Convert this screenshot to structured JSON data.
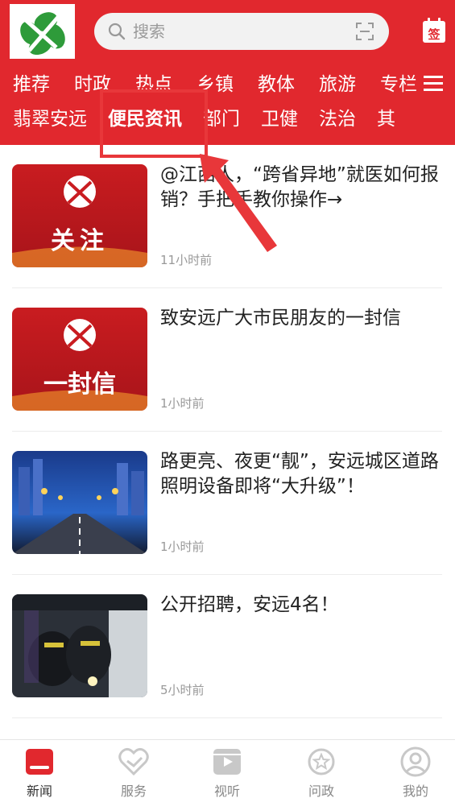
{
  "header": {
    "search": {
      "placeholder": "搜索"
    },
    "signin_label": "签"
  },
  "channels_row1": [
    "推荐",
    "时政",
    "热点",
    "乡镇",
    "教体",
    "旅游",
    "专栏"
  ],
  "channels_row2": [
    "翡翠安远",
    "便民资讯",
    "部门",
    "卫健",
    "法治",
    "其"
  ],
  "active_channel": "便民资讯",
  "feed": [
    {
      "title": "@江西人，“跨省异地”就医如何报销？手把手教你操作→",
      "time": "11小时前",
      "thumb_text": "关注"
    },
    {
      "title": "致安远广大市民朋友的一封信",
      "time": "1小时前",
      "thumb_text": "一封信"
    },
    {
      "title": "路更亮、夜更“靓”，安远城区道路照明设备即将“大升级”！",
      "time": "1小时前",
      "thumb_text": ""
    },
    {
      "title": "公开招聘，安远4名！",
      "time": "5小时前",
      "thumb_text": ""
    }
  ],
  "bottom_nav": [
    {
      "label": "新闻",
      "icon": "news-icon",
      "active": true
    },
    {
      "label": "服务",
      "icon": "service-icon",
      "active": false
    },
    {
      "label": "视听",
      "icon": "video-icon",
      "active": false
    },
    {
      "label": "问政",
      "icon": "inquiry-icon",
      "active": false
    },
    {
      "label": "我的",
      "icon": "profile-icon",
      "active": false
    }
  ],
  "colors": {
    "brand_red": "#e1282e",
    "annotation_red": "#e8373a"
  }
}
